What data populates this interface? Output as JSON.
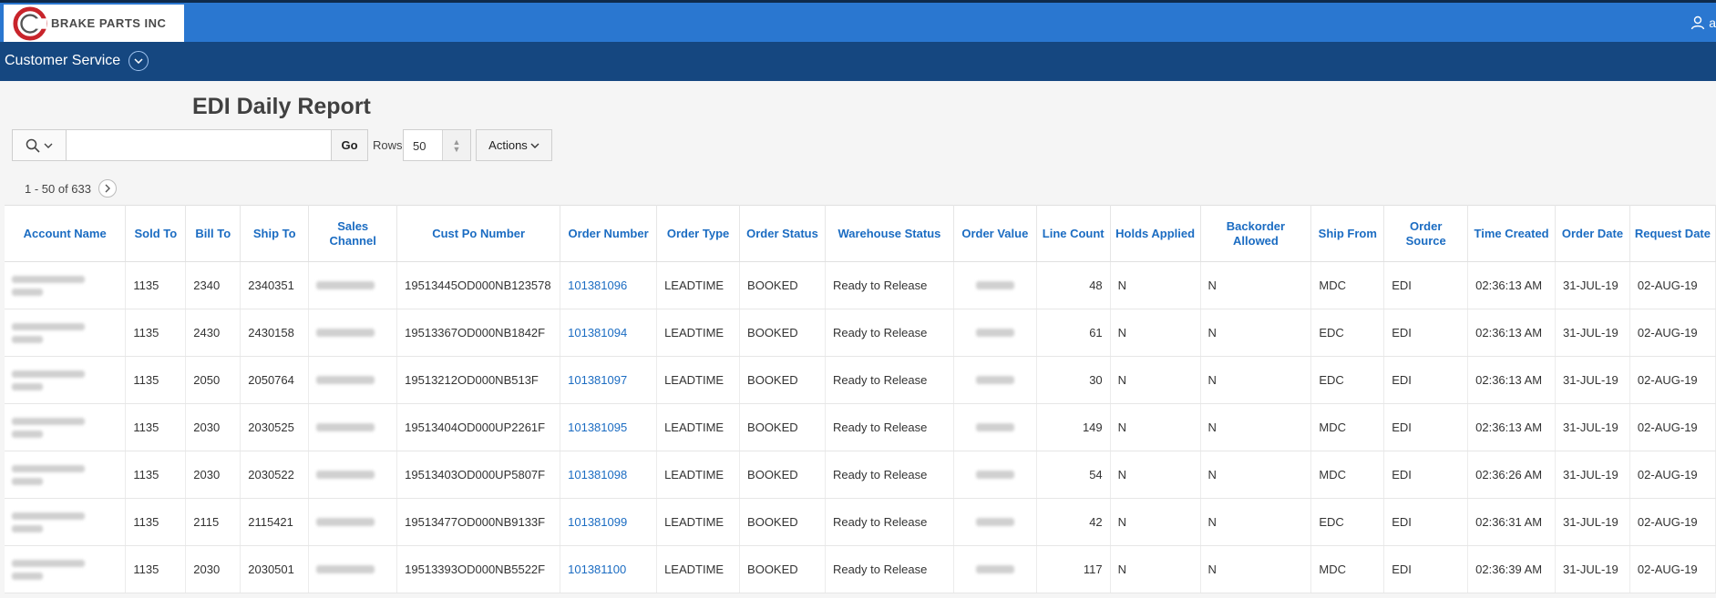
{
  "brand": {
    "name": "BRAKE PARTS INC",
    "accent": "#2a77d0",
    "nav_bg": "#154780",
    "logo_red": "#c8242b"
  },
  "user": {
    "initial": "a"
  },
  "nav": {
    "item": "Customer Service"
  },
  "page": {
    "title": "EDI Daily Report"
  },
  "toolbar": {
    "go_label": "Go",
    "rows_label": "Rows",
    "rows_value": "50",
    "actions_label": "Actions",
    "search_value": ""
  },
  "pagination": {
    "range": "1 - 50 of 633"
  },
  "table": {
    "columns": [
      "Account Name",
      "Sold To",
      "Bill To",
      "Ship To",
      "Sales Channel",
      "Cust Po Number",
      "Order Number",
      "Order Type",
      "Order Status",
      "Warehouse Status",
      "Order Value",
      "Line Count",
      "Holds Applied",
      "Backorder Allowed",
      "Ship From",
      "Order Source",
      "Time Created",
      "Order Date",
      "Request Date"
    ],
    "rows": [
      {
        "sold_to": "1135",
        "bill_to": "2340",
        "ship_to": "2340351",
        "cust_po": "19513445OD000NB123578",
        "order_number": "101381096",
        "order_type": "LEADTIME",
        "order_status": "BOOKED",
        "warehouse_status": "Ready to Release",
        "line_count": "48",
        "holds": "N",
        "backorder": "N",
        "ship_from": "MDC",
        "source": "EDI",
        "time_created": "02:36:13 AM",
        "order_date": "31-JUL-19",
        "request_date": "02-AUG-19"
      },
      {
        "sold_to": "1135",
        "bill_to": "2430",
        "ship_to": "2430158",
        "cust_po": "19513367OD000NB1842F",
        "order_number": "101381094",
        "order_type": "LEADTIME",
        "order_status": "BOOKED",
        "warehouse_status": "Ready to Release",
        "line_count": "61",
        "holds": "N",
        "backorder": "N",
        "ship_from": "EDC",
        "source": "EDI",
        "time_created": "02:36:13 AM",
        "order_date": "31-JUL-19",
        "request_date": "02-AUG-19"
      },
      {
        "sold_to": "1135",
        "bill_to": "2050",
        "ship_to": "2050764",
        "cust_po": "19513212OD000NB513F",
        "order_number": "101381097",
        "order_type": "LEADTIME",
        "order_status": "BOOKED",
        "warehouse_status": "Ready to Release",
        "line_count": "30",
        "holds": "N",
        "backorder": "N",
        "ship_from": "EDC",
        "source": "EDI",
        "time_created": "02:36:13 AM",
        "order_date": "31-JUL-19",
        "request_date": "02-AUG-19"
      },
      {
        "sold_to": "1135",
        "bill_to": "2030",
        "ship_to": "2030525",
        "cust_po": "19513404OD000UP2261F",
        "order_number": "101381095",
        "order_type": "LEADTIME",
        "order_status": "BOOKED",
        "warehouse_status": "Ready to Release",
        "line_count": "149",
        "holds": "N",
        "backorder": "N",
        "ship_from": "MDC",
        "source": "EDI",
        "time_created": "02:36:13 AM",
        "order_date": "31-JUL-19",
        "request_date": "02-AUG-19"
      },
      {
        "sold_to": "1135",
        "bill_to": "2030",
        "ship_to": "2030522",
        "cust_po": "19513403OD000UP5807F",
        "order_number": "101381098",
        "order_type": "LEADTIME",
        "order_status": "BOOKED",
        "warehouse_status": "Ready to Release",
        "line_count": "54",
        "holds": "N",
        "backorder": "N",
        "ship_from": "MDC",
        "source": "EDI",
        "time_created": "02:36:26 AM",
        "order_date": "31-JUL-19",
        "request_date": "02-AUG-19"
      },
      {
        "sold_to": "1135",
        "bill_to": "2115",
        "ship_to": "2115421",
        "cust_po": "19513477OD000NB9133F",
        "order_number": "101381099",
        "order_type": "LEADTIME",
        "order_status": "BOOKED",
        "warehouse_status": "Ready to Release",
        "line_count": "42",
        "holds": "N",
        "backorder": "N",
        "ship_from": "EDC",
        "source": "EDI",
        "time_created": "02:36:31 AM",
        "order_date": "31-JUL-19",
        "request_date": "02-AUG-19"
      },
      {
        "sold_to": "1135",
        "bill_to": "2030",
        "ship_to": "2030501",
        "cust_po": "19513393OD000NB5522F",
        "order_number": "101381100",
        "order_type": "LEADTIME",
        "order_status": "BOOKED",
        "warehouse_status": "Ready to Release",
        "line_count": "117",
        "holds": "N",
        "backorder": "N",
        "ship_from": "MDC",
        "source": "EDI",
        "time_created": "02:36:39 AM",
        "order_date": "31-JUL-19",
        "request_date": "02-AUG-19"
      }
    ]
  }
}
